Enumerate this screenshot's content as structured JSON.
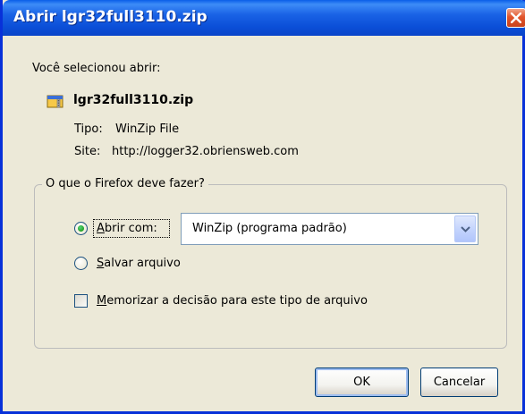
{
  "window": {
    "title": "Abrir lgr32full3110.zip"
  },
  "intro": {
    "text": "Você selecionou abrir:"
  },
  "file": {
    "name": "lgr32full3110.zip",
    "icon": "winzip-file-icon",
    "type_label": "Tipo:",
    "type_value": "WinZip File",
    "site_label": "Site:",
    "site_value": "http://logger32.obriensweb.com"
  },
  "action_group": {
    "legend": "O que o Firefox deve fazer?",
    "open_with": {
      "label_accel": "A",
      "label_rest": "brir com:",
      "selected": true
    },
    "app_select": {
      "value": "WinZip (programa padrão)"
    },
    "save_file": {
      "label_accel": "S",
      "label_rest": "alvar arquivo",
      "selected": false
    },
    "remember": {
      "label_accel": "M",
      "label_rest": "emorizar a decisão para este tipo de arquivo",
      "checked": false
    }
  },
  "buttons": {
    "ok": "OK",
    "cancel": "Cancelar"
  },
  "colors": {
    "titlebar": "#0b4fd8",
    "dialog_bg": "#ece9d8",
    "close_button": "#e2542b"
  }
}
